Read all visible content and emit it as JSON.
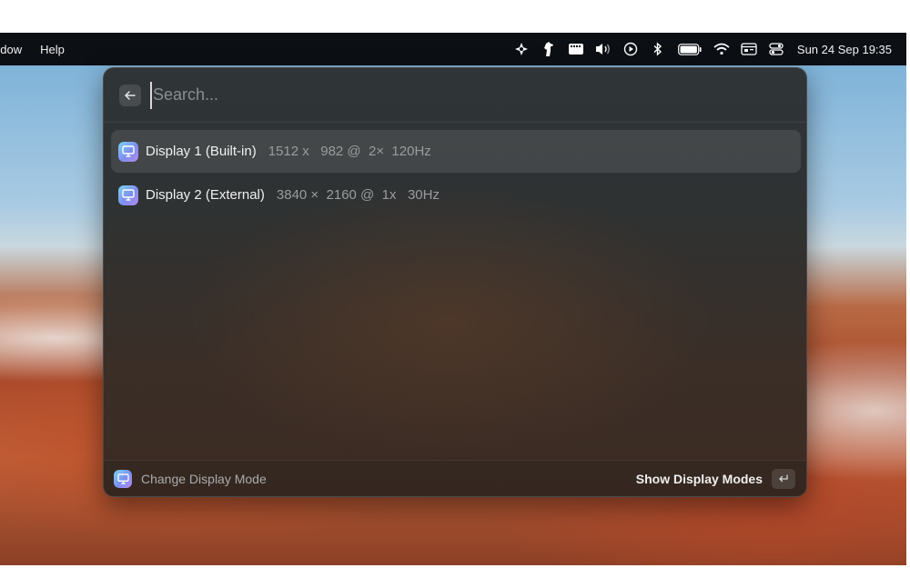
{
  "menubar": {
    "items": [
      "ndow",
      "Help"
    ],
    "clock": "Sun 24 Sep  19:35",
    "status_icons": [
      "wind-fan-icon",
      "horse-icon",
      "keyboard-card-icon",
      "volume-icon",
      "play-circle-icon",
      "bluetooth-icon",
      "battery-icon",
      "wifi-icon",
      "menu-window-icon",
      "control-center-icon"
    ]
  },
  "search": {
    "placeholder": "Search...",
    "value": ""
  },
  "results": [
    {
      "title": "Display 1 (Built-in)",
      "subtitle": "1512 x   982 @  2×  120Hz",
      "selected": true
    },
    {
      "title": "Display 2 (External)",
      "subtitle": "3840 ×  2160 @  1x   30Hz",
      "selected": false
    }
  ],
  "footer": {
    "title": "Change Display Mode",
    "action": "Show Display Modes"
  },
  "colors": {
    "menubar_bg": "#0c0f14",
    "panel_bg": "#2f3437",
    "icon_gradient_start": "#7ad3f2",
    "icon_gradient_end": "#b58bf0"
  }
}
